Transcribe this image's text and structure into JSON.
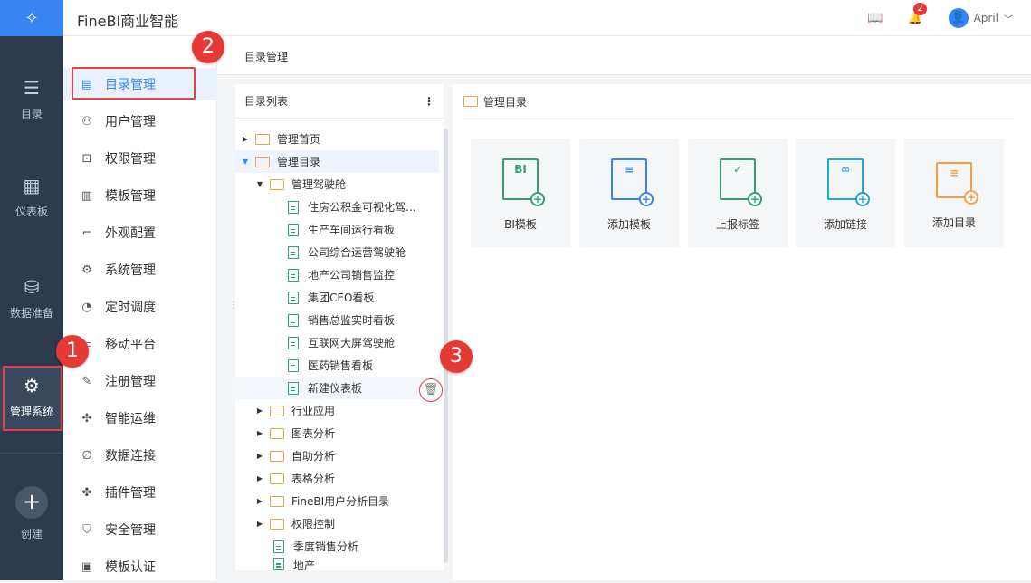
{
  "app": {
    "title": "FineBI商业智能"
  },
  "rail": {
    "items": [
      {
        "label": "目录",
        "icon": "list-icon"
      },
      {
        "label": "仪表板",
        "icon": "dashboard-icon"
      },
      {
        "label": "数据准备",
        "icon": "database-icon"
      },
      {
        "label": "管理系统",
        "icon": "gear-icon"
      }
    ],
    "create_label": "创建"
  },
  "topbar": {
    "badge_count": "2",
    "user_name": "April"
  },
  "submenu": {
    "items": [
      {
        "label": "目录管理"
      },
      {
        "label": "用户管理"
      },
      {
        "label": "权限管理"
      },
      {
        "label": "模板管理"
      },
      {
        "label": "外观配置"
      },
      {
        "label": "系统管理"
      },
      {
        "label": "定时调度"
      },
      {
        "label": "移动平台"
      },
      {
        "label": "注册管理"
      },
      {
        "label": "智能运维"
      },
      {
        "label": "数据连接"
      },
      {
        "label": "插件管理"
      },
      {
        "label": "安全管理"
      },
      {
        "label": "模板认证"
      }
    ]
  },
  "breadcrumb": "目录管理",
  "tree": {
    "header": "目录列表",
    "rows": [
      {
        "label": "管理首页"
      },
      {
        "label": "管理目录"
      },
      {
        "label": "管理驾驶舱"
      },
      {
        "label": "住房公积金可视化驾..."
      },
      {
        "label": "生产车间运行看板"
      },
      {
        "label": "公司综合运营驾驶舱"
      },
      {
        "label": "地产公司销售监控"
      },
      {
        "label": "集团CEO看板"
      },
      {
        "label": "销售总监实时看板"
      },
      {
        "label": "互联网大屏驾驶舱"
      },
      {
        "label": "医药销售看板"
      },
      {
        "label": "新建仪表板"
      },
      {
        "label": "行业应用"
      },
      {
        "label": "图表分析"
      },
      {
        "label": "自助分析"
      },
      {
        "label": "表格分析"
      },
      {
        "label": "FineBI用户分析目录"
      },
      {
        "label": "权限控制"
      },
      {
        "label": "季度销售分析"
      },
      {
        "label": "地产"
      }
    ]
  },
  "right": {
    "header": "管理目录",
    "cards": [
      {
        "label": "BI模板",
        "icon_text": "BI",
        "color": "#2fa079"
      },
      {
        "label": "添加模板",
        "color": "#3685f2"
      },
      {
        "label": "上报标签",
        "color": "#2fa079"
      },
      {
        "label": "添加链接",
        "color": "#1fa8d8"
      },
      {
        "label": "添加目录",
        "color": "#f2a14a"
      }
    ]
  },
  "steps": [
    "1",
    "2",
    "3"
  ]
}
